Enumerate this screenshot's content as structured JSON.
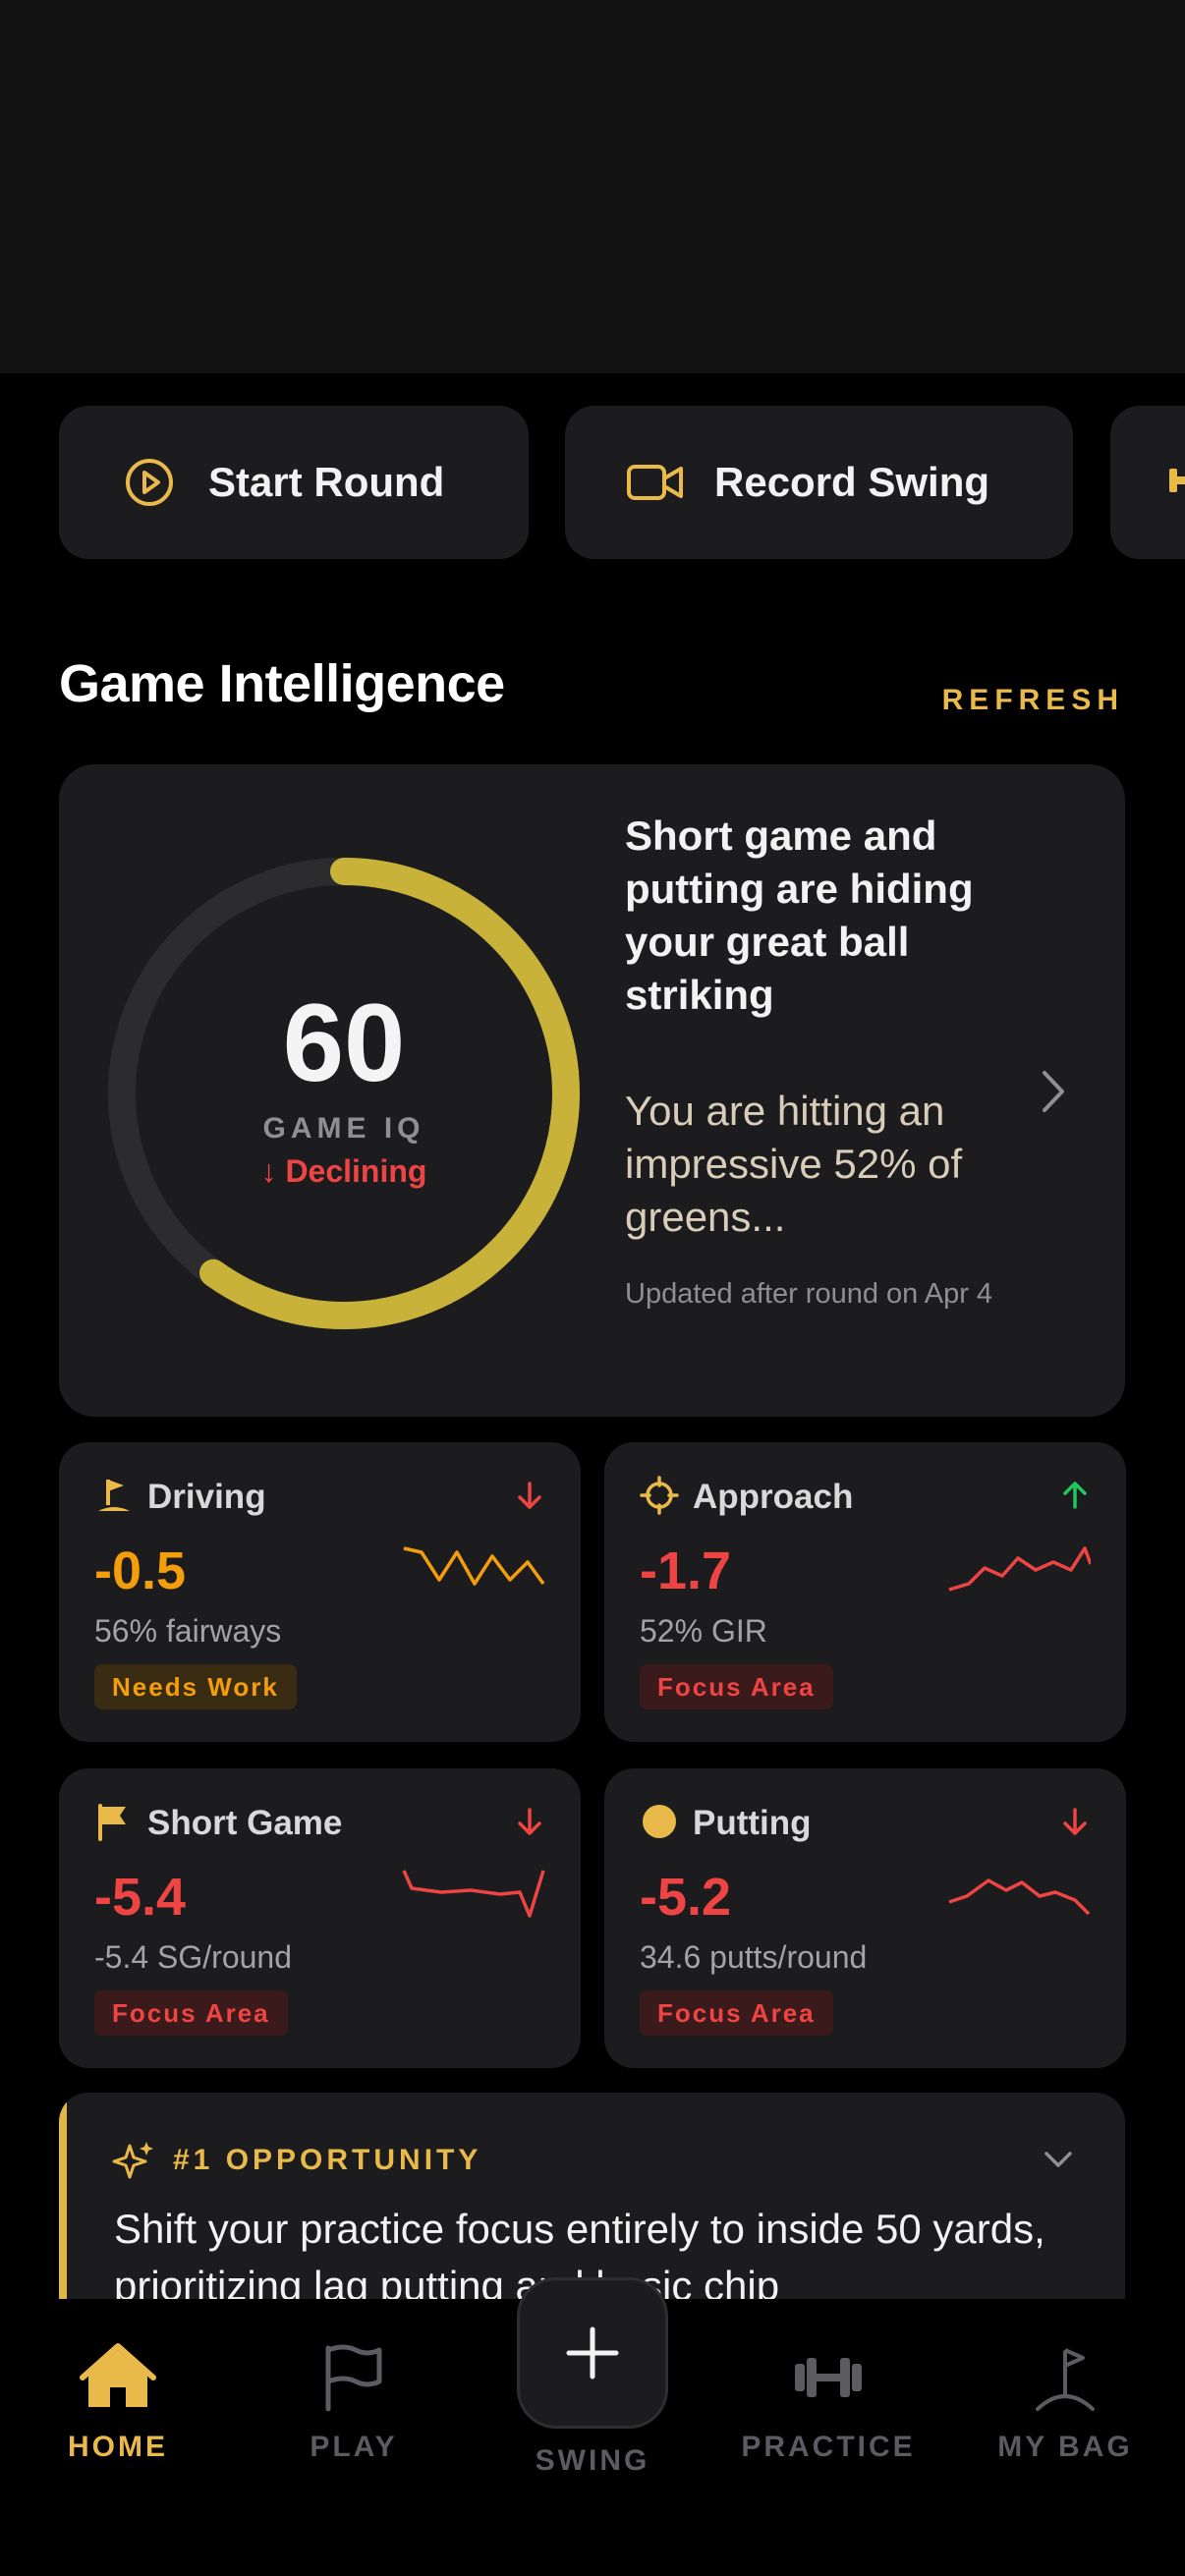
{
  "quick_actions": [
    {
      "label": "Start Round",
      "icon": "play-circle-icon"
    },
    {
      "label": "Record Swing",
      "icon": "video-camera-icon"
    },
    {
      "label": "",
      "icon": "dumbbell-icon"
    }
  ],
  "section": {
    "title": "Game Intelligence",
    "refresh_label": "REFRESH"
  },
  "game_iq": {
    "score": "60",
    "score_value": 60,
    "label": "GAME IQ",
    "trend": "↓ Declining",
    "headline": "Short game and putting are hiding your great ball striking",
    "body": "You are hitting an impressive 52% of greens...",
    "updated": "Updated after round on Apr 4"
  },
  "stats": [
    {
      "name": "Driving",
      "value": "-0.5",
      "sub": "56% fairways",
      "badge": "Needs Work",
      "trend": "down",
      "icon": "golf-flag-tee-icon",
      "color": "#f59e0b"
    },
    {
      "name": "Approach",
      "value": "-1.7",
      "sub": "52% GIR",
      "badge": "Focus Area",
      "trend": "up",
      "icon": "crosshair-icon",
      "color": "#ef4444"
    },
    {
      "name": "Short Game",
      "value": "-5.4",
      "sub": "-5.4 SG/round",
      "badge": "Focus Area",
      "trend": "down",
      "icon": "flag-icon",
      "color": "#ef4444"
    },
    {
      "name": "Putting",
      "value": "-5.2",
      "sub": "34.6 putts/round",
      "badge": "Focus Area",
      "trend": "down",
      "icon": "golf-ball-icon",
      "color": "#ef4444"
    }
  ],
  "opportunity": {
    "label": "#1 OPPORTUNITY",
    "text": "Shift your practice focus entirely to inside 50 yards, prioritizing lag putting and basic chip"
  },
  "tabs": [
    {
      "label": "HOME",
      "icon": "home-icon",
      "active": true
    },
    {
      "label": "PLAY",
      "icon": "flag-outline-icon",
      "active": false
    },
    {
      "label": "SWING",
      "icon": "plus-icon",
      "active": false
    },
    {
      "label": "PRACTICE",
      "icon": "dumbbell-icon",
      "active": false
    },
    {
      "label": "MY BAG",
      "icon": "golf-bag-icon",
      "active": false
    }
  ],
  "colors": {
    "accent": "#e9b94a",
    "ring": "#c9b23a",
    "negative": "#ef4444",
    "warning": "#f59e0b",
    "positive": "#22c55e"
  }
}
